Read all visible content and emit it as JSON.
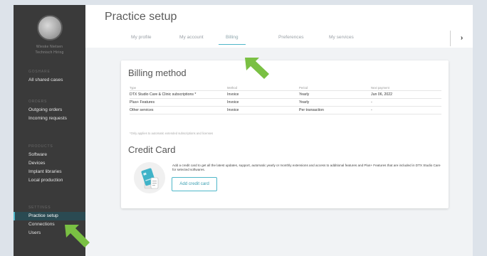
{
  "sidebar": {
    "user_name": "Wieske Nielsen",
    "user_role": "Technisch Hiring",
    "sections": [
      {
        "header": "GOSHARE",
        "items": [
          {
            "label": "All shared cases",
            "active": false
          }
        ]
      },
      {
        "header": "ORDERS",
        "items": [
          {
            "label": "Outgoing orders",
            "active": false
          },
          {
            "label": "Incoming requests",
            "active": false
          }
        ]
      },
      {
        "header": "PRODUCTS",
        "items": [
          {
            "label": "Software",
            "active": false
          },
          {
            "label": "Devices",
            "active": false
          },
          {
            "label": "Implant libraries",
            "active": false
          },
          {
            "label": "Local production",
            "active": false
          }
        ]
      },
      {
        "header": "SETTINGS",
        "items": [
          {
            "label": "Practice setup",
            "active": true
          },
          {
            "label": "Connections",
            "active": false
          },
          {
            "label": "Users",
            "active": false
          }
        ]
      }
    ]
  },
  "header": {
    "title": "Practice setup",
    "tabs": [
      {
        "label": "My profile",
        "active": false
      },
      {
        "label": "My account",
        "active": false
      },
      {
        "label": "Billing",
        "active": true
      },
      {
        "label": "Preferences",
        "active": false
      },
      {
        "label": "My services",
        "active": false
      }
    ],
    "next_label": "›"
  },
  "billing": {
    "title": "Billing method",
    "columns": [
      "Type",
      "Method",
      "Period",
      "Next payment"
    ],
    "rows": [
      [
        "DTX Studio Care & Clinic subscriptions *",
        "Invoice",
        "Yearly",
        "Jun 06, 2022"
      ],
      [
        "Plus+ Features",
        "Invoice",
        "Yearly",
        "-"
      ],
      [
        "Other services",
        "Invoice",
        "Per transaction",
        "-"
      ]
    ],
    "footnote": "*Only applies to automatic extended subscriptions and licenses"
  },
  "credit_card": {
    "title": "Credit Card",
    "description": "Add a credit card to get all the latest updates, support, automatic yearly or monthly extensions and access to additional features and Plus+ Features that are included in DTX Studio Care for selected softwares.",
    "button_label": "Add credit card"
  },
  "colors": {
    "accent": "#4fb7c9",
    "arrow": "#7ac043",
    "sidebar_bg": "#3a3a3a"
  }
}
